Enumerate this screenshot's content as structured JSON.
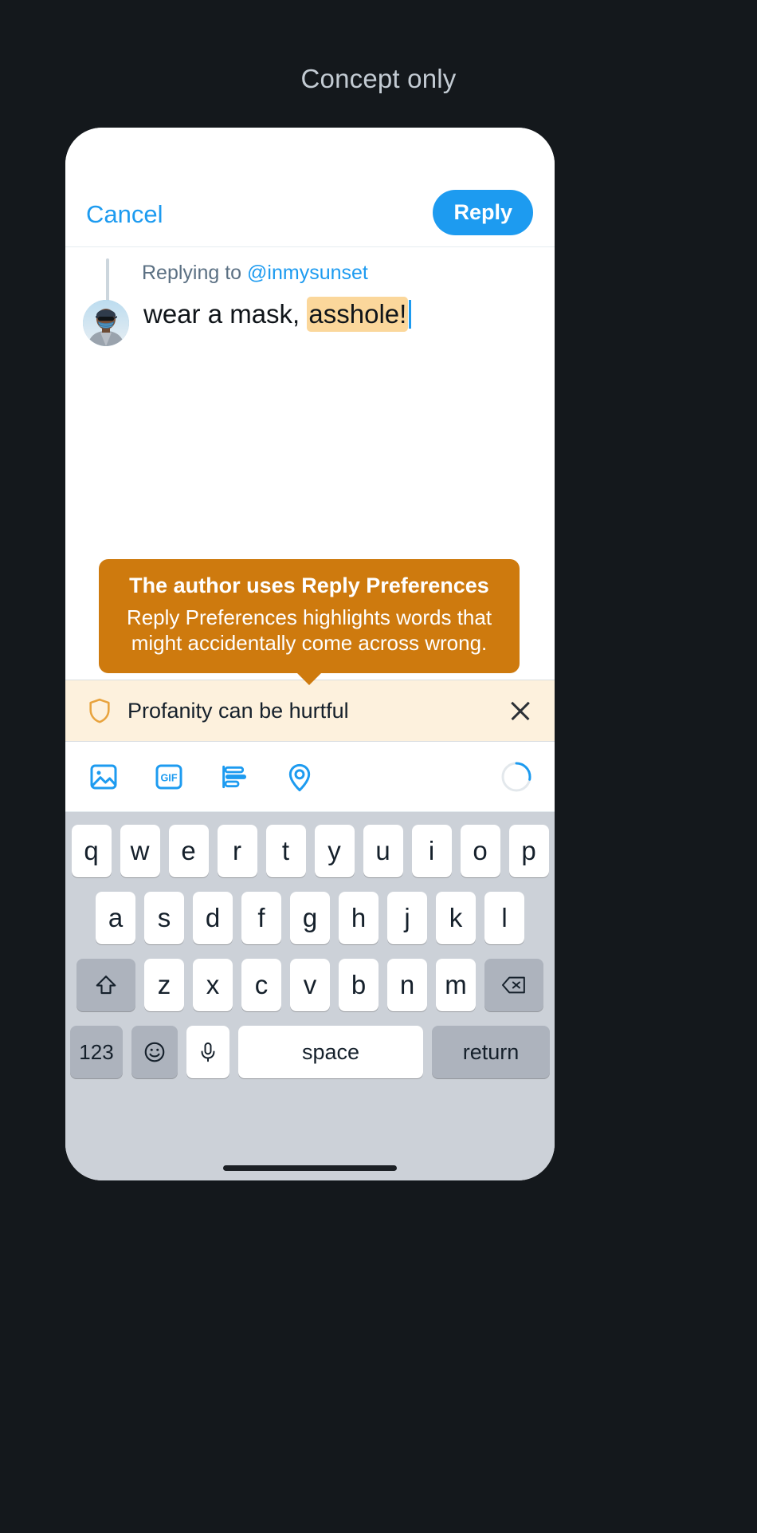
{
  "caption": "Concept only",
  "nav": {
    "cancel_label": "Cancel",
    "reply_label": "Reply"
  },
  "compose": {
    "replying_prefix": "Replying to ",
    "replying_handle": "@inmysunset",
    "text_before": "wear a mask, ",
    "text_highlighted": "asshole!",
    "avatar_name": "user-avatar-masked-person"
  },
  "tooltip": {
    "title": "The author uses Reply Preferences",
    "body": "Reply Preferences highlights words that might accidentally come across wrong."
  },
  "banner": {
    "text": "Profanity can be hurtful",
    "icon": "shield-icon",
    "close_icon": "close-icon"
  },
  "toolbar": {
    "icons": [
      {
        "name": "image-icon",
        "label": "Image"
      },
      {
        "name": "gif-icon",
        "label": "GIF"
      },
      {
        "name": "poll-icon",
        "label": "Poll"
      },
      {
        "name": "location-icon",
        "label": "Location"
      }
    ],
    "char_counter_icon": "character-count-ring"
  },
  "keyboard": {
    "row1": [
      "q",
      "w",
      "e",
      "r",
      "t",
      "y",
      "u",
      "i",
      "o",
      "p"
    ],
    "row2": [
      "a",
      "s",
      "d",
      "f",
      "g",
      "h",
      "j",
      "k",
      "l"
    ],
    "row3": [
      "z",
      "x",
      "c",
      "v",
      "b",
      "n",
      "m"
    ],
    "shift_label": "⇧",
    "backspace_label": "⌫",
    "numbers_label": "123",
    "emoji_label": "☺",
    "mic_label": "🎤",
    "space_label": "space",
    "return_label": "return"
  },
  "colors": {
    "accent_blue": "#1d9bf0",
    "highlight": "#fbd79b",
    "tooltip_bg": "#ce7a0e",
    "banner_bg": "#fdf1dd",
    "page_bg": "#14181c"
  }
}
